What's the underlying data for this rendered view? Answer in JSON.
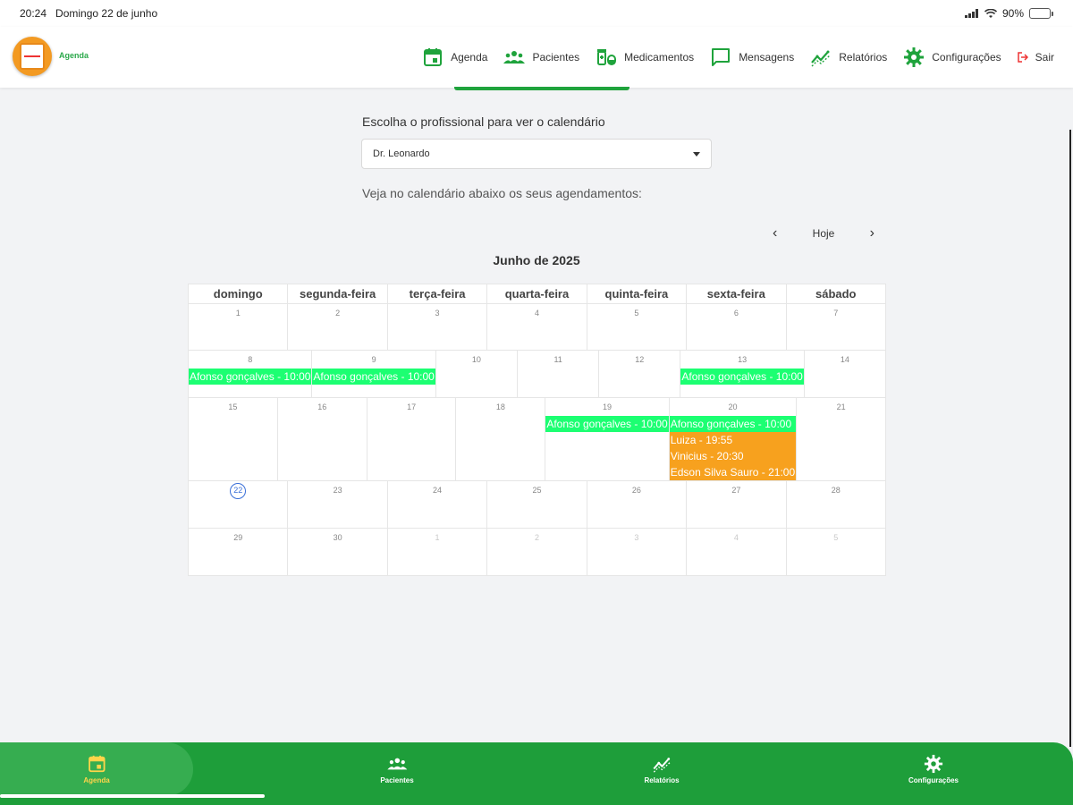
{
  "status_bar": {
    "time": "20:24",
    "date": "Domingo 22 de junho",
    "battery": "90%",
    "battery_level": 0.9
  },
  "header": {
    "logo_text": "Agenda",
    "nav": [
      {
        "label": "Agenda",
        "icon": "calendar-icon"
      },
      {
        "label": "Pacientes",
        "icon": "people-icon"
      },
      {
        "label": "Medicamentos",
        "icon": "medication-icon"
      },
      {
        "label": "Mensagens",
        "icon": "message-icon"
      },
      {
        "label": "Relatórios",
        "icon": "chart-icon"
      },
      {
        "label": "Configurações",
        "icon": "gear-icon"
      },
      {
        "label": "Sair",
        "icon": "exit-icon"
      }
    ]
  },
  "professional": {
    "label": "Escolha o profissional para ver o calendário",
    "selected": "Dr. Leonardo"
  },
  "hint": "Veja no calendário abaixo os seus agendamentos:",
  "calendar": {
    "today_label": "Hoje",
    "month_title": "Junho de 2025",
    "weekdays": [
      "domingo",
      "segunda-feira",
      "terça-feira",
      "quarta-feira",
      "quinta-feira",
      "sexta-feira",
      "sábado"
    ],
    "weeks": [
      [
        {
          "d": "1"
        },
        {
          "d": "2"
        },
        {
          "d": "3"
        },
        {
          "d": "4"
        },
        {
          "d": "5"
        },
        {
          "d": "6"
        },
        {
          "d": "7"
        }
      ],
      [
        {
          "d": "8",
          "events": [
            {
              "t": "Afonso gonçalves - 10:00",
              "c": "green"
            }
          ]
        },
        {
          "d": "9",
          "events": [
            {
              "t": "Afonso gonçalves - 10:00",
              "c": "green"
            }
          ]
        },
        {
          "d": "10"
        },
        {
          "d": "11"
        },
        {
          "d": "12"
        },
        {
          "d": "13",
          "events": [
            {
              "t": "Afonso gonçalves - 10:00",
              "c": "green"
            }
          ]
        },
        {
          "d": "14"
        }
      ],
      [
        {
          "d": "15"
        },
        {
          "d": "16"
        },
        {
          "d": "17"
        },
        {
          "d": "18"
        },
        {
          "d": "19",
          "events": [
            {
              "t": "Afonso gonçalves - 10:00",
              "c": "green"
            }
          ]
        },
        {
          "d": "20",
          "events": [
            {
              "t": "Afonso gonçalves - 10:00",
              "c": "green"
            },
            {
              "t": "Luiza - 19:55",
              "c": "orange"
            },
            {
              "t": "Vinicius - 20:30",
              "c": "orange"
            },
            {
              "t": "Edson Silva Sauro - 21:00",
              "c": "orange"
            }
          ]
        },
        {
          "d": "21"
        }
      ],
      [
        {
          "d": "22",
          "today": true
        },
        {
          "d": "23"
        },
        {
          "d": "24"
        },
        {
          "d": "25"
        },
        {
          "d": "26"
        },
        {
          "d": "27"
        },
        {
          "d": "28"
        }
      ],
      [
        {
          "d": "29"
        },
        {
          "d": "30"
        },
        {
          "d": "1",
          "other": true
        },
        {
          "d": "2",
          "other": true
        },
        {
          "d": "3",
          "other": true
        },
        {
          "d": "4",
          "other": true
        },
        {
          "d": "5",
          "other": true
        }
      ]
    ]
  },
  "bottom_tabs": [
    {
      "label": "Agenda",
      "icon": "calendar-icon",
      "active": true
    },
    {
      "label": "Pacientes",
      "icon": "people-icon"
    },
    {
      "label": "Relatórios",
      "icon": "chart-icon"
    },
    {
      "label": "Configurações",
      "icon": "gear-icon"
    }
  ],
  "colors": {
    "brand_green": "#1e9e3a",
    "event_green": "#1cff72",
    "event_orange": "#f7a11e",
    "active_tab": "#ffd54a"
  }
}
